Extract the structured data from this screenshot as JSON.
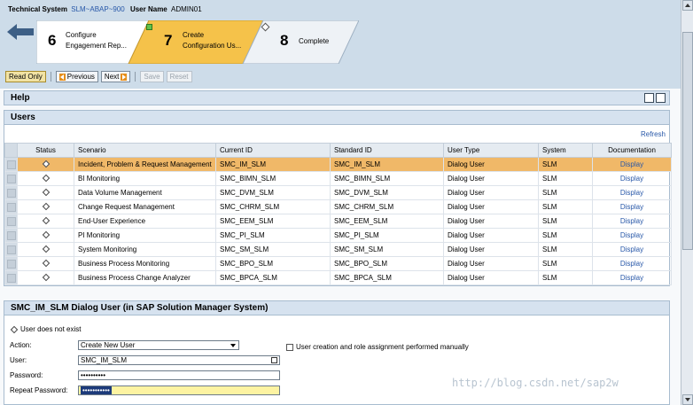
{
  "header": {
    "system_label": "Technical System",
    "system_value": "SLM~ABAP~900",
    "user_label": "User Name",
    "user_value": "ADMIN01"
  },
  "roadmap": {
    "steps": [
      {
        "number": "6",
        "label_line1": "Configure",
        "label_line2": "Engagement Rep..."
      },
      {
        "number": "7",
        "label_line1": "Create",
        "label_line2": "Configuration Us..."
      },
      {
        "number": "8",
        "label_line1": "Complete",
        "label_line2": ""
      }
    ]
  },
  "toolbar": {
    "read_only": "Read Only",
    "previous": "Previous",
    "next": "Next",
    "save": "Save",
    "reset": "Reset"
  },
  "help_panel": {
    "title": "Help"
  },
  "users_panel": {
    "title": "Users",
    "refresh": "Refresh",
    "columns": [
      "Status",
      "Scenario",
      "Current ID",
      "Standard ID",
      "User Type",
      "System",
      "Documentation"
    ],
    "rows": [
      {
        "scenario": "Incident, Problem & Request Management",
        "current_id": "SMC_IM_SLM",
        "standard_id": "SMC_IM_SLM",
        "user_type": "Dialog User",
        "system": "SLM",
        "doc": "Display"
      },
      {
        "scenario": "BI Monitoring",
        "current_id": "SMC_BIMN_SLM",
        "standard_id": "SMC_BIMN_SLM",
        "user_type": "Dialog User",
        "system": "SLM",
        "doc": "Display"
      },
      {
        "scenario": "Data Volume Management",
        "current_id": "SMC_DVM_SLM",
        "standard_id": "SMC_DVM_SLM",
        "user_type": "Dialog User",
        "system": "SLM",
        "doc": "Display"
      },
      {
        "scenario": "Change Request Management",
        "current_id": "SMC_CHRM_SLM",
        "standard_id": "SMC_CHRM_SLM",
        "user_type": "Dialog User",
        "system": "SLM",
        "doc": "Display"
      },
      {
        "scenario": "End-User Experience",
        "current_id": "SMC_EEM_SLM",
        "standard_id": "SMC_EEM_SLM",
        "user_type": "Dialog User",
        "system": "SLM",
        "doc": "Display"
      },
      {
        "scenario": "PI Monitoring",
        "current_id": "SMC_PI_SLM",
        "standard_id": "SMC_PI_SLM",
        "user_type": "Dialog User",
        "system": "SLM",
        "doc": "Display"
      },
      {
        "scenario": "System Monitoring",
        "current_id": "SMC_SM_SLM",
        "standard_id": "SMC_SM_SLM",
        "user_type": "Dialog User",
        "system": "SLM",
        "doc": "Display"
      },
      {
        "scenario": "Business Process Monitoring",
        "current_id": "SMC_BPO_SLM",
        "standard_id": "SMC_BPO_SLM",
        "user_type": "Dialog User",
        "system": "SLM",
        "doc": "Display"
      },
      {
        "scenario": "Business Process Change Analyzer",
        "current_id": "SMC_BPCA_SLM",
        "standard_id": "SMC_BPCA_SLM",
        "user_type": "Dialog User",
        "system": "SLM",
        "doc": "Display"
      }
    ]
  },
  "detail": {
    "title": "SMC_IM_SLM Dialog User (in SAP Solution Manager System)",
    "status_message": "User does not exist",
    "action_label": "Action:",
    "action_value": "Create New User",
    "user_label": "User:",
    "user_value": "SMC_IM_SLM",
    "password_label": "Password:",
    "password_value": "••••••••••",
    "repeat_password_label": "Repeat Password:",
    "repeat_password_value": "•••••••••••",
    "manual_checkbox_label": "User creation and role assignment performed manually"
  },
  "watermark": "http://blog.csdn.net/sap2w",
  "colors": {
    "selected_row": "#f0b868",
    "step_active": "#f5c24a",
    "link": "#2757a8"
  }
}
